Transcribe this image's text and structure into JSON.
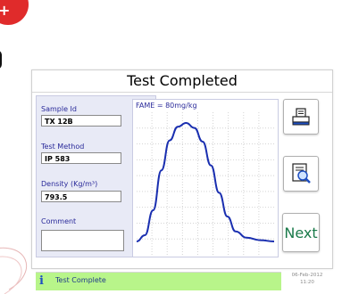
{
  "window": {
    "title": "Test Completed"
  },
  "fields": {
    "sample_id": {
      "label": "Sample Id",
      "value": "TX 12B"
    },
    "test_method": {
      "label": "Test Method",
      "value": "IP 583"
    },
    "density": {
      "label": "Density (Kg/m³)",
      "value": "793.5"
    },
    "comment": {
      "label": "Comment",
      "value": ""
    }
  },
  "chart": {
    "title": "FAME = 80mg/kg"
  },
  "chart_data": {
    "type": "line",
    "title": "FAME = 80mg/kg",
    "xlabel": "",
    "ylabel": "",
    "grid": true,
    "series": [
      {
        "values": [
          [
            0.0,
            0.05
          ],
          [
            0.06,
            0.1
          ],
          [
            0.12,
            0.3
          ],
          [
            0.18,
            0.62
          ],
          [
            0.24,
            0.86
          ],
          [
            0.3,
            0.97
          ],
          [
            0.36,
            1.0
          ],
          [
            0.42,
            0.96
          ],
          [
            0.48,
            0.85
          ],
          [
            0.54,
            0.66
          ],
          [
            0.6,
            0.44
          ],
          [
            0.66,
            0.25
          ],
          [
            0.72,
            0.13
          ],
          [
            0.8,
            0.08
          ],
          [
            0.9,
            0.06
          ],
          [
            1.0,
            0.05
          ]
        ]
      }
    ]
  },
  "buttons": {
    "print": {
      "icon": "printer-icon"
    },
    "view": {
      "icon": "document-search-icon"
    },
    "next": {
      "label": "Next"
    }
  },
  "status": {
    "icon": "info-icon",
    "glyph": "i",
    "text": "Test Complete"
  },
  "datetime": {
    "date": "06-Feb-2012",
    "time": "11:20"
  },
  "colors": {
    "curve": "#1a2fb0",
    "status_bg": "#b8f58a",
    "next_text": "#1a7a4a",
    "label": "#2a2a9a"
  }
}
